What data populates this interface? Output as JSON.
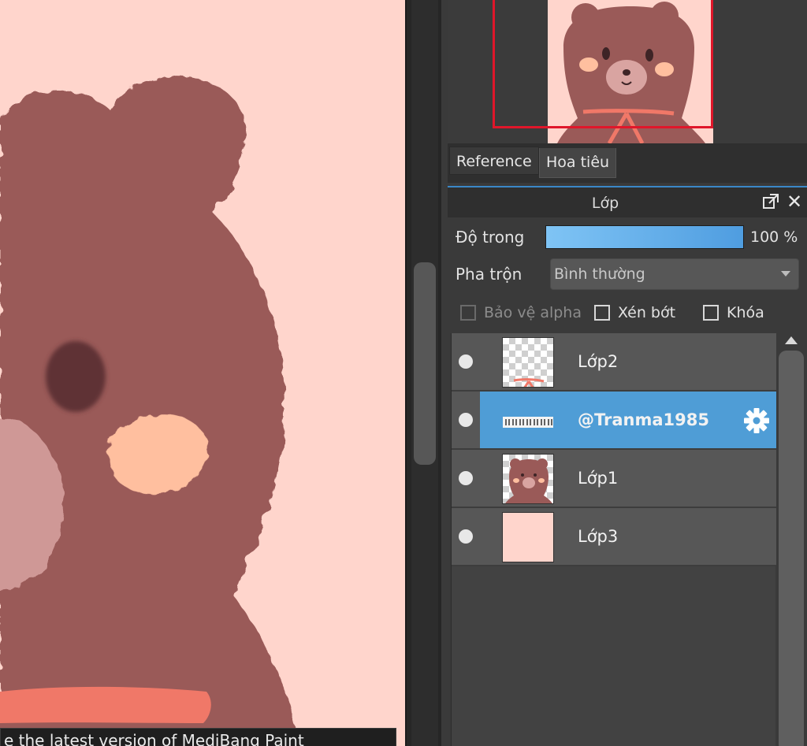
{
  "toast": {
    "text": "e the latest version of MediBang Paint"
  },
  "navigator": {
    "tabs": [
      {
        "label": "Reference"
      },
      {
        "label": "Hoa tiêu"
      }
    ]
  },
  "layer_panel": {
    "title": "Lớp",
    "opacity_label": "Độ trong",
    "opacity_value": "100 %",
    "opacity_level": 1.0,
    "blend_label": "Pha trộn",
    "blend_value": "Bình thường",
    "protect_alpha": {
      "label": "Bảo vệ alpha",
      "checked": false,
      "enabled": false
    },
    "clipping": {
      "label": "Xén bớt",
      "checked": false
    },
    "lock": {
      "label": "Khóa",
      "checked": false
    },
    "layers": [
      {
        "name": "Lớp2",
        "visible": true,
        "selected": false,
        "thumb": "ribbon"
      },
      {
        "name": "@Tranma1985",
        "visible": true,
        "selected": true,
        "thumb": "text-strip"
      },
      {
        "name": "Lớp1",
        "visible": true,
        "selected": false,
        "thumb": "bear"
      },
      {
        "name": "Lớp3",
        "visible": true,
        "selected": false,
        "thumb": "solid"
      }
    ]
  },
  "colors": {
    "canvas_bg": "#ffd5cc",
    "bear_fur": "#9a5a58",
    "cheek": "#ffbf9f",
    "ribbon": "#f07868",
    "selected_row": "#4f9dd6",
    "nav_viewport": "#e0162a"
  },
  "icons": {
    "popout": "popout-icon",
    "close": "close-icon",
    "visibility": "eye-icon",
    "settings": "gear-icon"
  }
}
